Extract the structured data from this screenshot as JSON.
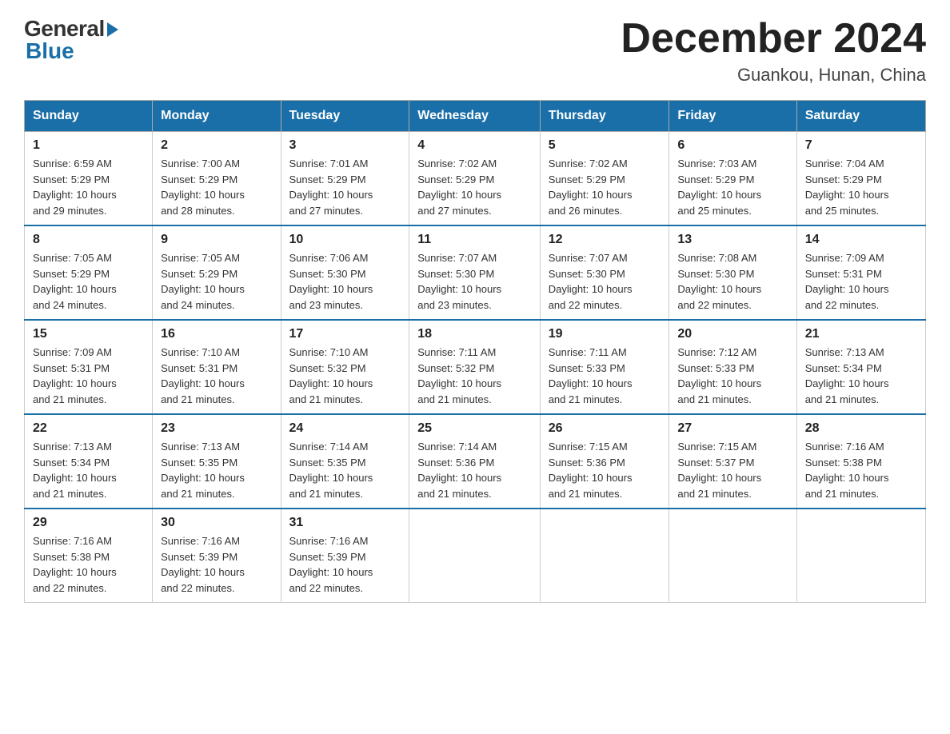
{
  "header": {
    "logo_general": "General",
    "logo_blue": "Blue",
    "month_year": "December 2024",
    "location": "Guankou, Hunan, China"
  },
  "days_of_week": [
    "Sunday",
    "Monday",
    "Tuesday",
    "Wednesday",
    "Thursday",
    "Friday",
    "Saturday"
  ],
  "weeks": [
    [
      {
        "day": "1",
        "sunrise": "6:59 AM",
        "sunset": "5:29 PM",
        "daylight": "10 hours and 29 minutes."
      },
      {
        "day": "2",
        "sunrise": "7:00 AM",
        "sunset": "5:29 PM",
        "daylight": "10 hours and 28 minutes."
      },
      {
        "day": "3",
        "sunrise": "7:01 AM",
        "sunset": "5:29 PM",
        "daylight": "10 hours and 27 minutes."
      },
      {
        "day": "4",
        "sunrise": "7:02 AM",
        "sunset": "5:29 PM",
        "daylight": "10 hours and 27 minutes."
      },
      {
        "day": "5",
        "sunrise": "7:02 AM",
        "sunset": "5:29 PM",
        "daylight": "10 hours and 26 minutes."
      },
      {
        "day": "6",
        "sunrise": "7:03 AM",
        "sunset": "5:29 PM",
        "daylight": "10 hours and 25 minutes."
      },
      {
        "day": "7",
        "sunrise": "7:04 AM",
        "sunset": "5:29 PM",
        "daylight": "10 hours and 25 minutes."
      }
    ],
    [
      {
        "day": "8",
        "sunrise": "7:05 AM",
        "sunset": "5:29 PM",
        "daylight": "10 hours and 24 minutes."
      },
      {
        "day": "9",
        "sunrise": "7:05 AM",
        "sunset": "5:29 PM",
        "daylight": "10 hours and 24 minutes."
      },
      {
        "day": "10",
        "sunrise": "7:06 AM",
        "sunset": "5:30 PM",
        "daylight": "10 hours and 23 minutes."
      },
      {
        "day": "11",
        "sunrise": "7:07 AM",
        "sunset": "5:30 PM",
        "daylight": "10 hours and 23 minutes."
      },
      {
        "day": "12",
        "sunrise": "7:07 AM",
        "sunset": "5:30 PM",
        "daylight": "10 hours and 22 minutes."
      },
      {
        "day": "13",
        "sunrise": "7:08 AM",
        "sunset": "5:30 PM",
        "daylight": "10 hours and 22 minutes."
      },
      {
        "day": "14",
        "sunrise": "7:09 AM",
        "sunset": "5:31 PM",
        "daylight": "10 hours and 22 minutes."
      }
    ],
    [
      {
        "day": "15",
        "sunrise": "7:09 AM",
        "sunset": "5:31 PM",
        "daylight": "10 hours and 21 minutes."
      },
      {
        "day": "16",
        "sunrise": "7:10 AM",
        "sunset": "5:31 PM",
        "daylight": "10 hours and 21 minutes."
      },
      {
        "day": "17",
        "sunrise": "7:10 AM",
        "sunset": "5:32 PM",
        "daylight": "10 hours and 21 minutes."
      },
      {
        "day": "18",
        "sunrise": "7:11 AM",
        "sunset": "5:32 PM",
        "daylight": "10 hours and 21 minutes."
      },
      {
        "day": "19",
        "sunrise": "7:11 AM",
        "sunset": "5:33 PM",
        "daylight": "10 hours and 21 minutes."
      },
      {
        "day": "20",
        "sunrise": "7:12 AM",
        "sunset": "5:33 PM",
        "daylight": "10 hours and 21 minutes."
      },
      {
        "day": "21",
        "sunrise": "7:13 AM",
        "sunset": "5:34 PM",
        "daylight": "10 hours and 21 minutes."
      }
    ],
    [
      {
        "day": "22",
        "sunrise": "7:13 AM",
        "sunset": "5:34 PM",
        "daylight": "10 hours and 21 minutes."
      },
      {
        "day": "23",
        "sunrise": "7:13 AM",
        "sunset": "5:35 PM",
        "daylight": "10 hours and 21 minutes."
      },
      {
        "day": "24",
        "sunrise": "7:14 AM",
        "sunset": "5:35 PM",
        "daylight": "10 hours and 21 minutes."
      },
      {
        "day": "25",
        "sunrise": "7:14 AM",
        "sunset": "5:36 PM",
        "daylight": "10 hours and 21 minutes."
      },
      {
        "day": "26",
        "sunrise": "7:15 AM",
        "sunset": "5:36 PM",
        "daylight": "10 hours and 21 minutes."
      },
      {
        "day": "27",
        "sunrise": "7:15 AM",
        "sunset": "5:37 PM",
        "daylight": "10 hours and 21 minutes."
      },
      {
        "day": "28",
        "sunrise": "7:16 AM",
        "sunset": "5:38 PM",
        "daylight": "10 hours and 21 minutes."
      }
    ],
    [
      {
        "day": "29",
        "sunrise": "7:16 AM",
        "sunset": "5:38 PM",
        "daylight": "10 hours and 22 minutes."
      },
      {
        "day": "30",
        "sunrise": "7:16 AM",
        "sunset": "5:39 PM",
        "daylight": "10 hours and 22 minutes."
      },
      {
        "day": "31",
        "sunrise": "7:16 AM",
        "sunset": "5:39 PM",
        "daylight": "10 hours and 22 minutes."
      },
      null,
      null,
      null,
      null
    ]
  ],
  "labels": {
    "sunrise": "Sunrise:",
    "sunset": "Sunset:",
    "daylight": "Daylight:"
  }
}
